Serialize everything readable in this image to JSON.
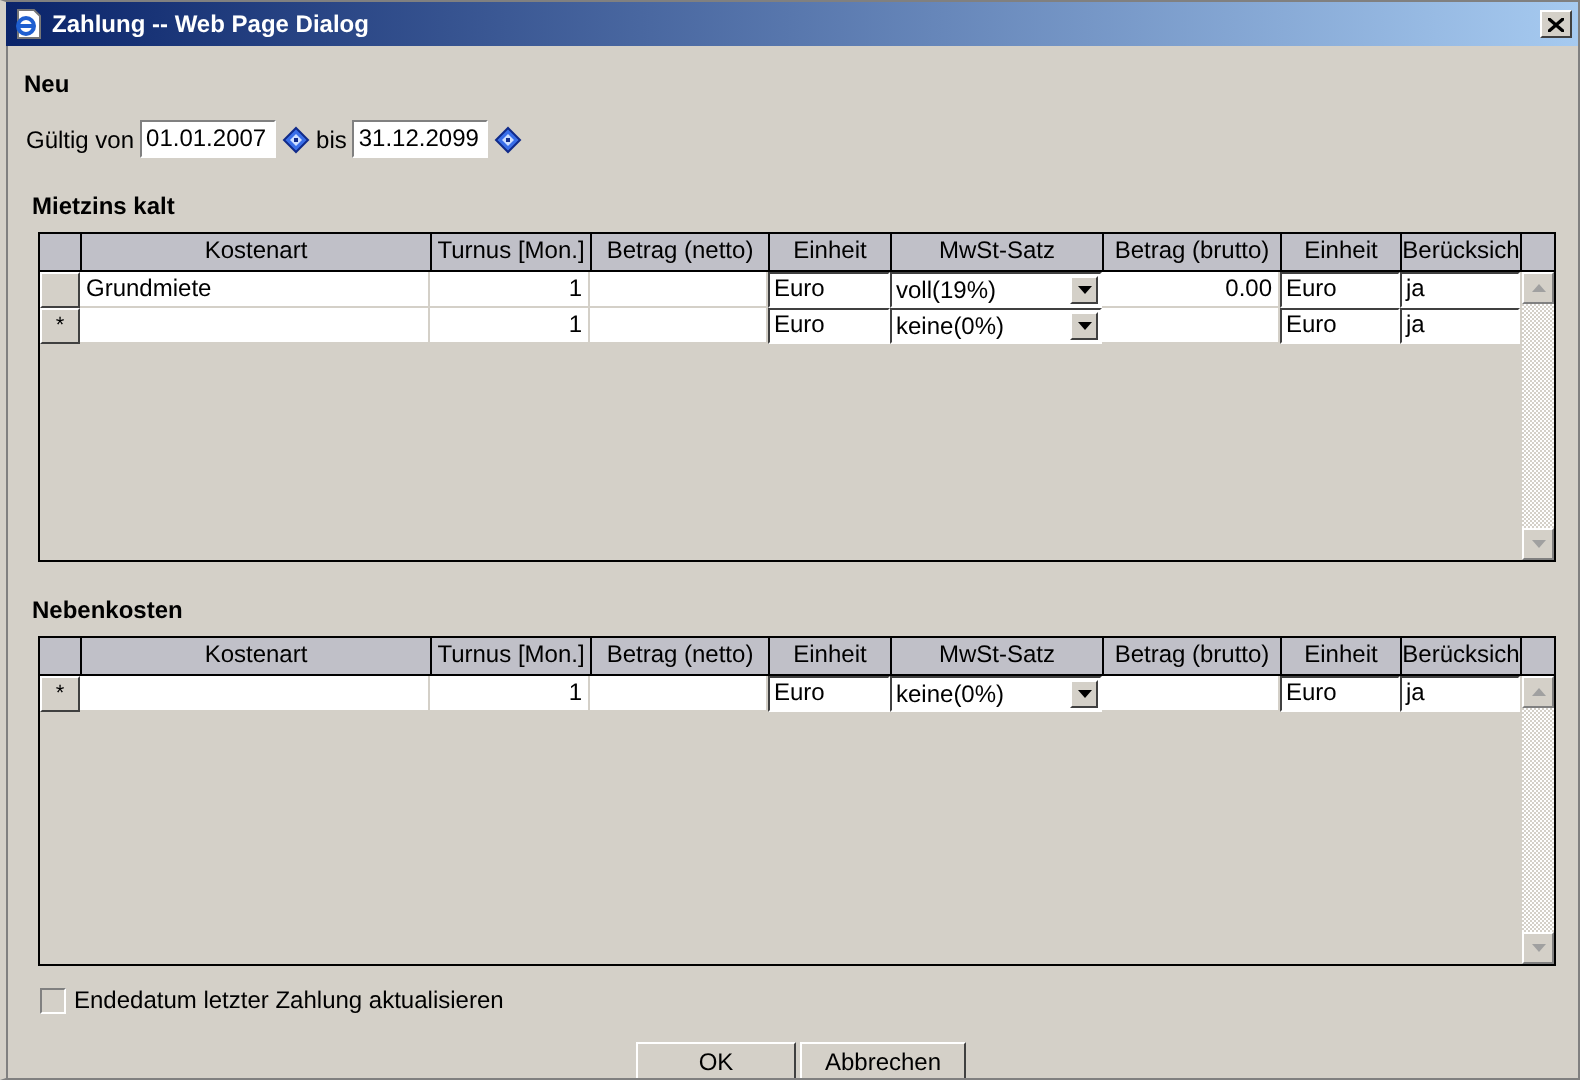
{
  "window": {
    "title": "Zahlung -- Web Page Dialog"
  },
  "heading": "Neu",
  "validity": {
    "from_label": "Gültig von",
    "from": "01.01.2007",
    "to_label": "bis",
    "to": "31.12.2099"
  },
  "sections": [
    {
      "title": "Mietzins kalt",
      "columns": [
        {
          "label": "Kostenart",
          "kind": "text"
        },
        {
          "label": "Turnus [Mon.]",
          "kind": "number"
        },
        {
          "label": "Betrag (netto)",
          "kind": "number"
        },
        {
          "label": "Einheit",
          "kind": "input"
        },
        {
          "label": "MwSt-Satz",
          "kind": "select"
        },
        {
          "label": "Betrag (brutto)",
          "kind": "number"
        },
        {
          "label": "Einheit",
          "kind": "input"
        },
        {
          "label": "Berücksich",
          "kind": "input"
        }
      ],
      "rows": [
        {
          "marker": "",
          "cells": [
            "Grundmiete",
            "1",
            "",
            "Euro",
            "voll(19%)",
            "0.00",
            "Euro",
            "ja"
          ]
        },
        {
          "marker": "*",
          "cells": [
            "",
            "1",
            "",
            "Euro",
            "keine(0%)",
            "",
            "Euro",
            "ja"
          ]
        }
      ]
    },
    {
      "title": "Nebenkosten",
      "columns": [
        {
          "label": "Kostenart",
          "kind": "text"
        },
        {
          "label": "Turnus [Mon.]",
          "kind": "number"
        },
        {
          "label": "Betrag (netto)",
          "kind": "number"
        },
        {
          "label": "Einheit",
          "kind": "input"
        },
        {
          "label": "MwSt-Satz",
          "kind": "select"
        },
        {
          "label": "Betrag (brutto)",
          "kind": "number"
        },
        {
          "label": "Einheit",
          "kind": "input"
        },
        {
          "label": "Berücksich",
          "kind": "input"
        }
      ],
      "rows": [
        {
          "marker": "*",
          "cells": [
            "",
            "1",
            "",
            "Euro",
            "keine(0%)",
            "",
            "Euro",
            "ja"
          ]
        }
      ]
    }
  ],
  "checkbox": {
    "label": "Endedatum letzter Zahlung aktualisieren",
    "checked": false
  },
  "buttons": [
    "OK",
    "Abbrechen"
  ]
}
